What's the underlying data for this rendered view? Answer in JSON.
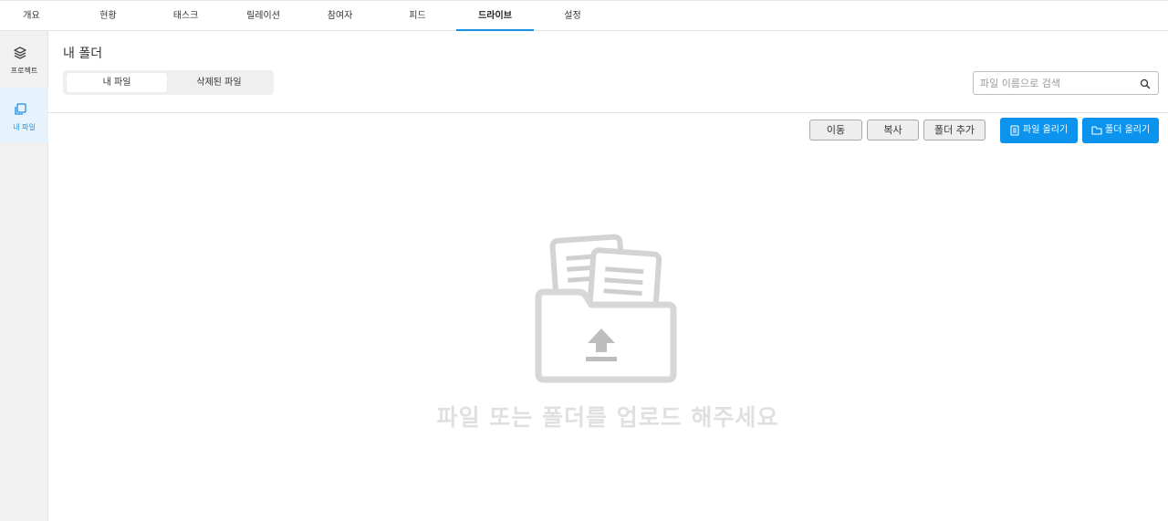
{
  "tabs": [
    {
      "label": "개요"
    },
    {
      "label": "현황"
    },
    {
      "label": "태스크"
    },
    {
      "label": "릴레이션"
    },
    {
      "label": "참여자"
    },
    {
      "label": "피드"
    },
    {
      "label": "드라이브"
    },
    {
      "label": "설정"
    }
  ],
  "active_tab": "드라이브",
  "sidebar": {
    "items": [
      {
        "label": "프로젝트",
        "icon": "layers-icon"
      },
      {
        "label": "내 파일",
        "icon": "files-icon"
      }
    ]
  },
  "page_title": "내 폴더",
  "segments": [
    {
      "label": "내 파일"
    },
    {
      "label": "삭제된 파일"
    }
  ],
  "search": {
    "placeholder": "파일 이름으로 검색",
    "value": ""
  },
  "toolbar": {
    "move": "이동",
    "copy": "복사",
    "add_folder": "폴더 추가",
    "upload_file": "파일 올리기",
    "upload_folder": "폴더 올리기"
  },
  "empty_state": {
    "message": "파일 또는 폴더를 업로드 해주세요",
    "icon": "folder-upload-icon"
  },
  "colors": {
    "accent": "#0b93ee",
    "active_tab_underline": "#1a8fe3",
    "sidebar_bg": "#f1f1f1"
  }
}
